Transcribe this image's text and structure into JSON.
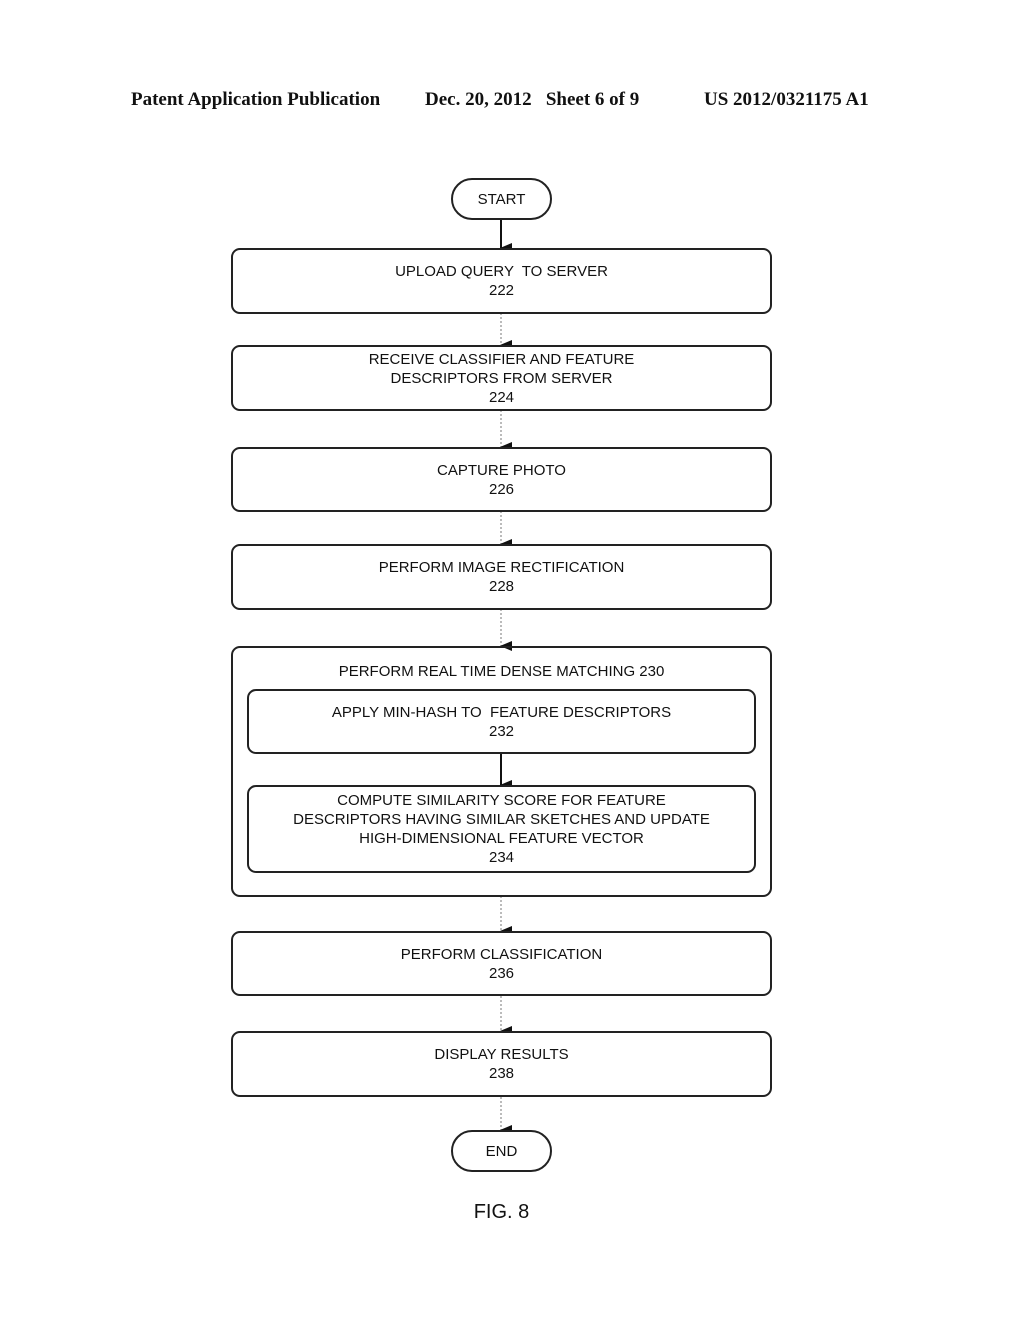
{
  "header": {
    "publication": "Patent Application Publication",
    "date_sheet": "Dec. 20, 2012   Sheet 6 of 9",
    "number": "US 2012/0321175 A1"
  },
  "flowchart": {
    "start": "START",
    "end": "END",
    "steps": [
      {
        "lines": [
          "UPLOAD QUERY  TO SERVER"
        ],
        "ref": "222"
      },
      {
        "lines": [
          "RECEIVE CLASSIFIER AND FEATURE",
          "DESCRIPTORS FROM SERVER"
        ],
        "ref": "224"
      },
      {
        "lines": [
          "CAPTURE PHOTO"
        ],
        "ref": "226"
      },
      {
        "lines": [
          "PERFORM IMAGE RECTIFICATION"
        ],
        "ref": "228"
      }
    ],
    "group": {
      "title": "PERFORM REAL TIME DENSE MATCHING 230",
      "substeps": [
        {
          "lines": [
            "APPLY MIN-HASH TO  FEATURE DESCRIPTORS"
          ],
          "ref": "232"
        },
        {
          "lines": [
            "COMPUTE SIMILARITY SCORE FOR FEATURE",
            "DESCRIPTORS HAVING SIMILAR SKETCHES AND UPDATE",
            "HIGH-DIMENSIONAL FEATURE VECTOR"
          ],
          "ref": "234"
        }
      ]
    },
    "after_steps": [
      {
        "lines": [
          "PERFORM CLASSIFICATION"
        ],
        "ref": "236"
      },
      {
        "lines": [
          "DISPLAY RESULTS"
        ],
        "ref": "238"
      }
    ]
  },
  "figure_label": "FIG. 8"
}
